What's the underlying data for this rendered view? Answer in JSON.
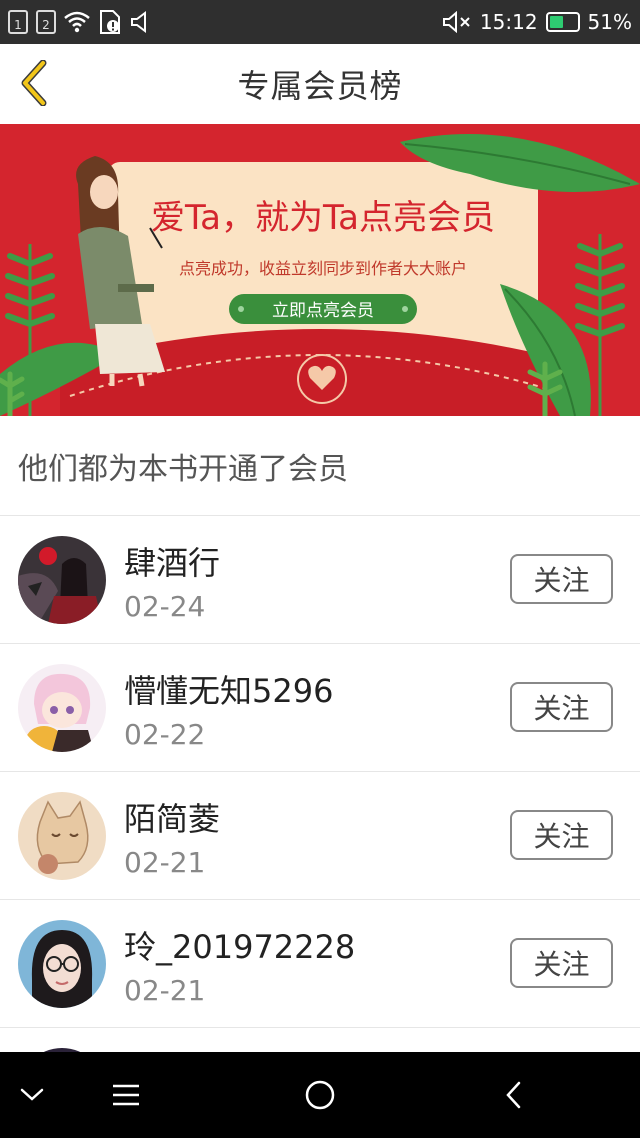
{
  "status_bar": {
    "sim1": "1",
    "sim2": "2",
    "time": "15:12",
    "battery": "51%",
    "battery_level": 0.51,
    "icons": [
      "sim-1-icon",
      "sim-2-icon",
      "wifi-icon",
      "sd-card-icon",
      "mute-icon",
      "battery-icon"
    ]
  },
  "header": {
    "title": "专属会员榜",
    "back_icon": "chevron-left-icon"
  },
  "banner": {
    "headline": "爱Ta，就为Ta点亮会员",
    "subline": "点亮成功，收益立刻同步到作者大大账户",
    "cta": "立即点亮会员",
    "colors": {
      "background": "#d4252e",
      "card": "#fbe3c4",
      "cta": "#3a8f3c",
      "leaf": "#3f9b46"
    }
  },
  "section": {
    "title": "他们都为本书开通了会员"
  },
  "members": [
    {
      "name": "肆酒行",
      "date": "02-24",
      "follow_label": "关注"
    },
    {
      "name": "懵懂无知5296",
      "date": "02-22",
      "follow_label": "关注"
    },
    {
      "name": "陌简菱",
      "date": "02-21",
      "follow_label": "关注"
    },
    {
      "name": "玲_201972228",
      "date": "02-21",
      "follow_label": "关注"
    }
  ],
  "nav_bar": {
    "icons": [
      "chevron-down-icon",
      "menu-icon",
      "home-circle-icon",
      "back-icon"
    ]
  }
}
